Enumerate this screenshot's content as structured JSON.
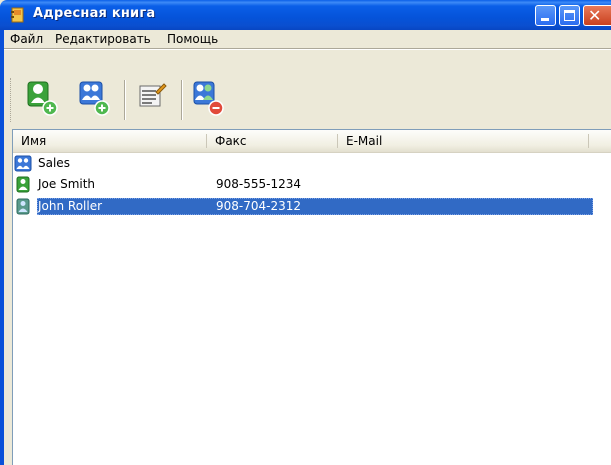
{
  "window": {
    "title": "Адресная книга",
    "controls": [
      "minimize",
      "maximize",
      "close"
    ]
  },
  "menu": {
    "file": "Файл",
    "edit": "Редактировать",
    "help": "Помощь"
  },
  "toolbar": {
    "buttons": [
      {
        "icon": "add-contact-icon"
      },
      {
        "icon": "add-group-icon"
      },
      {
        "icon": "edit-icon"
      },
      {
        "icon": "delete-contact-icon"
      }
    ]
  },
  "columns": [
    "Имя",
    "Факс",
    "E-Mail"
  ],
  "rows": [
    {
      "name": "Sales",
      "fax": "",
      "email": "",
      "type": "group"
    },
    {
      "name": "Joe Smith",
      "fax": "908-555-1234",
      "email": "",
      "type": "contact"
    },
    {
      "name": "John Roller",
      "fax": "908-704-2312",
      "email": "",
      "type": "contact",
      "selected": true
    }
  ],
  "colors": {
    "titlebar": "#0553d9",
    "selection": "#316ac5",
    "frame": "#ece9d8"
  }
}
